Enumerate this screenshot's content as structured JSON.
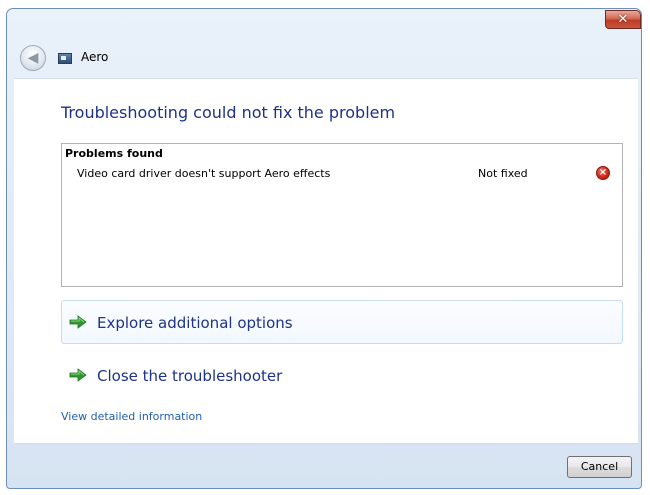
{
  "window": {
    "title": "Aero",
    "close_glyph": "✕",
    "back_glyph": "◀"
  },
  "main": {
    "heading": "Troubleshooting could not fix the problem",
    "problems": {
      "header": "Problems found",
      "rows": [
        {
          "description": "Video card driver doesn't support Aero effects",
          "status": "Not fixed",
          "status_icon": "error-icon"
        }
      ]
    },
    "options": [
      {
        "label": "Explore additional options",
        "icon": "green-arrow-icon",
        "hovered": true
      },
      {
        "label": "Close the troubleshooter",
        "icon": "green-arrow-icon",
        "hovered": false
      }
    ],
    "details_link": "View detailed information"
  },
  "footer": {
    "cancel_label": "Cancel"
  },
  "colors": {
    "heading": "#1e3287",
    "link": "#1f5fb3",
    "error": "#d0291a",
    "arrow": "#2e9b2e"
  }
}
